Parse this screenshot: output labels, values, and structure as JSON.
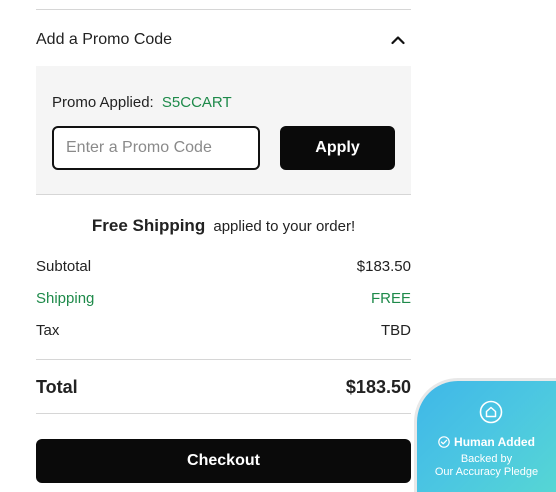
{
  "promo": {
    "header_label": "Add a Promo Code",
    "applied_label": "Promo Applied:",
    "applied_code": "S5CCART",
    "input_placeholder": "Enter a Promo Code",
    "input_value": "",
    "apply_label": "Apply"
  },
  "shipping_banner": {
    "bold": "Free Shipping",
    "rest": "applied to your order!"
  },
  "summary": {
    "subtotal_label": "Subtotal",
    "subtotal_value": "$183.50",
    "shipping_label": "Shipping",
    "shipping_value": "FREE",
    "tax_label": "Tax",
    "tax_value": "TBD",
    "total_label": "Total",
    "total_value": "$183.50"
  },
  "checkout_label": "Checkout",
  "pledge_badge": {
    "title": "Human Added",
    "line1": "Backed by",
    "line2": "Our Accuracy Pledge"
  },
  "colors": {
    "accent_green": "#1e8a4a",
    "button_black": "#0a0a0a",
    "panel_bg": "#f5f5f5",
    "badge_gradient_start": "#3fb7e8",
    "badge_gradient_end": "#56d6d4"
  },
  "icons": {
    "promo_toggle": "chevron-up-icon",
    "badge_top": "home-icon",
    "badge_check": "check-circle-icon"
  }
}
